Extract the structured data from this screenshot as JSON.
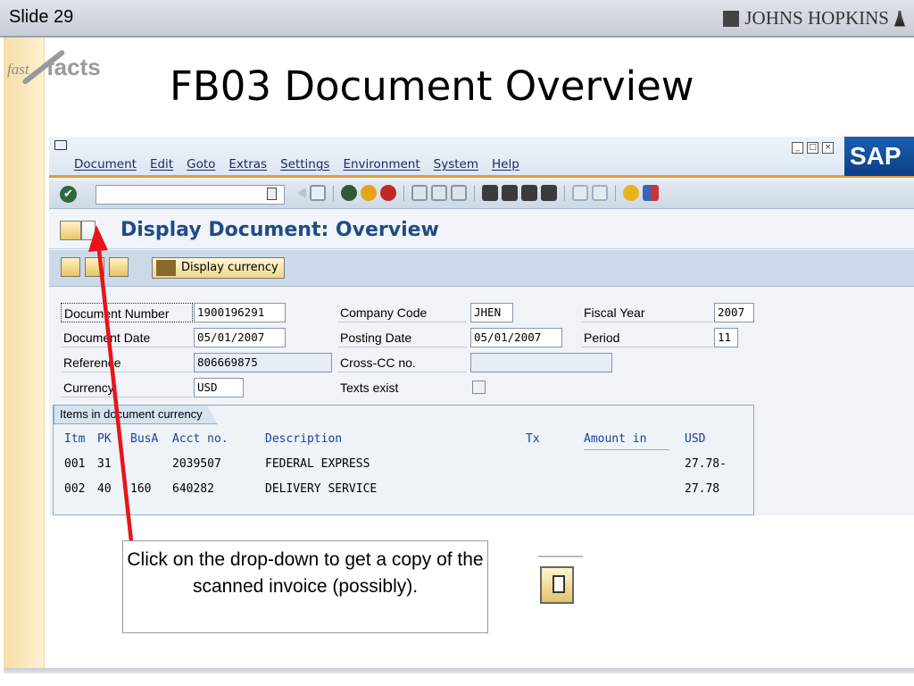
{
  "slide": {
    "label": "Slide 29",
    "institution": "JOHNS HOPKINS",
    "logo_text_fast": "fast",
    "logo_text_facts": "facts",
    "title": "FB03 Document Overview"
  },
  "sap": {
    "menu": [
      "Document",
      "Edit",
      "Goto",
      "Extras",
      "Settings",
      "Environment",
      "System",
      "Help"
    ],
    "command_field": "",
    "logo": "SAP",
    "screen_title": "Display Document: Overview",
    "app_toolbar": {
      "display_currency_label": "Display currency"
    },
    "header_fields": {
      "document_number": {
        "label": "Document Number",
        "value": "1900196291"
      },
      "document_date": {
        "label": "Document Date",
        "value": "05/01/2007"
      },
      "reference": {
        "label": "Reference",
        "value": "806669875"
      },
      "currency": {
        "label": "Currency",
        "value": "USD"
      },
      "company_code": {
        "label": "Company Code",
        "value": "JHEN"
      },
      "posting_date": {
        "label": "Posting Date",
        "value": "05/01/2007"
      },
      "cross_cc_no": {
        "label": "Cross-CC no.",
        "value": ""
      },
      "texts_exist": {
        "label": "Texts exist",
        "checked": false
      },
      "fiscal_year": {
        "label": "Fiscal Year",
        "value": "2007"
      },
      "period": {
        "label": "Period",
        "value": "11"
      }
    },
    "items": {
      "tab_label": "Items in document currency",
      "headers": {
        "itm": "Itm",
        "pk": "PK",
        "busa": "BusA",
        "acct": "Acct no.",
        "desc": "Description",
        "tx": "Tx",
        "amount": "Amount in",
        "curr": "USD"
      },
      "rows": [
        {
          "itm": "001",
          "pk": "31",
          "busa": "",
          "acct": "2039507",
          "desc": "FEDERAL EXPRESS",
          "amount": "27.78-"
        },
        {
          "itm": "002",
          "pk": "40",
          "busa": "160",
          "acct": "640282",
          "desc": "DELIVERY SERVICE",
          "amount": "27.78"
        }
      ]
    }
  },
  "callout": {
    "text": "Click on the drop-down to get a copy of the scanned invoice (possibly)."
  },
  "colors": {
    "sap_title": "#1f4b87",
    "arrow": "#e8141a",
    "menu_accent": "#e59a3a",
    "header_text": "#1b3e9c"
  }
}
